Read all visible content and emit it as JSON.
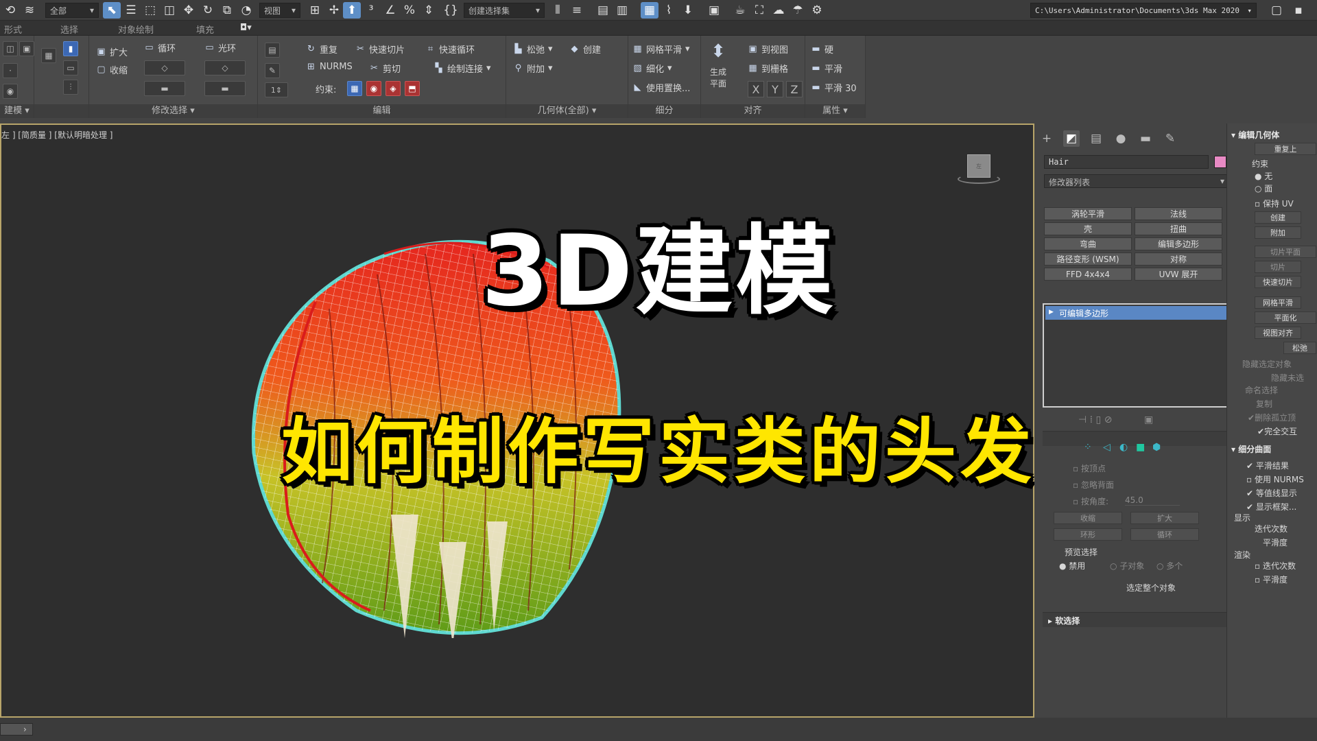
{
  "toolbar": {
    "selection_filter": "全部",
    "view_dropdown": "视图",
    "named_selection": "创建选择集",
    "project_path": "C:\\Users\\Administrator\\Documents\\3ds Max 2020"
  },
  "ribbon_tabs": [
    "形式",
    "选择",
    "对象绘制",
    "填充"
  ],
  "ribbon": {
    "groups": {
      "modeling": "建模",
      "modify_selection": "修改选择",
      "edit": "编辑",
      "geometry": "几何体(全部)",
      "subdivision": "细分",
      "align": "对齐",
      "properties": "属性"
    },
    "modify_selection": {
      "grow": "扩大",
      "shrink": "收缩",
      "loop": "循环",
      "ring": "光环"
    },
    "edit": {
      "repeat": "重复",
      "quickslice": "快速切片",
      "quickloop": "快速循环",
      "nurms": "NURMS",
      "cut": "剪切",
      "paint_connect": "绘制连接",
      "constraints": "约束:",
      "spinner_value": "1"
    },
    "geometry": {
      "relax": "松弛",
      "create": "创建",
      "attach": "附加"
    },
    "subdivision": {
      "meshsmooth": "网格平滑",
      "tessellate": "细化",
      "use_displace": "使用置换..."
    },
    "align": {
      "make_planar": "生成平面",
      "to_view": "到视图",
      "to_grid": "到栅格",
      "x": "X",
      "y": "Y",
      "z": "Z"
    },
    "properties": {
      "hard": "硬",
      "smooth": "平滑",
      "smooth30": "平滑 30"
    }
  },
  "viewport": {
    "label": "左 ] [简质量 ] [默认明暗处理 ]",
    "viewcube_text": "左"
  },
  "overlay": {
    "title": "3D建模",
    "subtitle": "如何制作写实类的头发"
  },
  "command_panel": {
    "object_name": "Hair",
    "modifier_list": "修改器列表",
    "modifier_buttons": [
      [
        "涡轮平滑",
        "法线"
      ],
      [
        "壳",
        "扭曲"
      ],
      [
        "弯曲",
        "编辑多边形"
      ],
      [
        "路径变形 (WSM)",
        "对称"
      ],
      [
        "FFD 4x4x4",
        "UVW 展开"
      ]
    ],
    "stack_item": "可编辑多边形",
    "selection": {
      "by_vertex": "按顶点",
      "ignore_backfacing": "忽略背面",
      "by_angle": "按角度:",
      "angle_value": "45.0",
      "shrink": "收缩",
      "grow": "扩大",
      "ring": "环形",
      "loop": "循环",
      "preview_selection": "预览选择",
      "disabled": "禁用",
      "subobject": "子对象",
      "multi": "多个",
      "whole_object": "选定整个对象"
    },
    "soft_selection": "软选择"
  },
  "right_panel": {
    "edit_geometry": "编辑几何体",
    "repeat_last": "重复上",
    "constraints": "约束",
    "none": "无",
    "face": "面",
    "preserve_uv": "保持 UV",
    "create": "创建",
    "attach": "附加",
    "slice_plane": "切片平面",
    "slice": "切片",
    "quickslice": "快速切片",
    "meshsmooth": "网格平滑",
    "planarize": "平面化",
    "view_align": "视图对齐",
    "relax": "松弛",
    "hide_selected": "隐藏选定对象",
    "hide_unselected": "隐藏未选",
    "named_selection": "命名选择",
    "copy": "复制",
    "delete_isolated": "删除孤立顶",
    "full_interactivity": "完全交互",
    "subdivision_surface": "细分曲面",
    "smooth_result": "平滑结果",
    "use_nurms": "使用 NURMS",
    "isoline_display": "等值线显示",
    "show_cage": "显示框架...",
    "display": "显示",
    "iterations": "迭代次数",
    "smoothness": "平滑度",
    "render": "渲染",
    "iterations2": "迭代次数",
    "smoothness2": "平滑度"
  }
}
